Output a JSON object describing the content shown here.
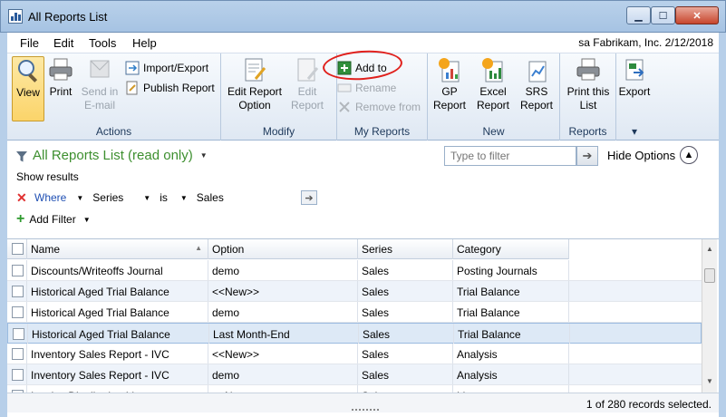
{
  "window": {
    "title": "All Reports List"
  },
  "menu": {
    "items": [
      "File",
      "Edit",
      "Tools",
      "Help"
    ],
    "company": "sa  Fabrikam, Inc.  2/12/2018"
  },
  "ribbon": {
    "actions": {
      "label": "Actions",
      "view": "View",
      "print": "Print",
      "send": "Send in E-mail",
      "import_export": "Import/Export",
      "publish": "Publish Report"
    },
    "modify": {
      "label": "Modify",
      "edit_option": "Edit Report Option",
      "edit_report": "Edit Report"
    },
    "my_reports": {
      "label": "My Reports",
      "add_to": "Add to",
      "rename": "Rename",
      "remove_from": "Remove from"
    },
    "new": {
      "label": "New",
      "gp": "GP Report",
      "excel": "Excel Report",
      "srs": "SRS Report"
    },
    "reports": {
      "label": "Reports",
      "print_list": "Print this List"
    },
    "export": {
      "label": "Export"
    }
  },
  "filter": {
    "list_title": "All Reports List (read only)",
    "search_placeholder": "Type to filter",
    "hide_options": "Hide Options",
    "show_results": "Show results",
    "where": "Where",
    "field": "Series",
    "operator": "is",
    "value": "Sales",
    "add_filter": "Add Filter"
  },
  "grid": {
    "columns": [
      "Name",
      "Option",
      "Series",
      "Category"
    ],
    "rows": [
      {
        "name": "Discounts/Writeoffs Journal",
        "option": "demo",
        "series": "Sales",
        "category": "Posting Journals"
      },
      {
        "name": "Historical Aged Trial Balance",
        "option": "<<New>>",
        "series": "Sales",
        "category": "Trial Balance"
      },
      {
        "name": "Historical Aged Trial Balance",
        "option": "demo",
        "series": "Sales",
        "category": "Trial Balance"
      },
      {
        "name": "Historical Aged Trial Balance",
        "option": "Last Month-End",
        "series": "Sales",
        "category": "Trial Balance"
      },
      {
        "name": "Inventory Sales Report - IVC",
        "option": "<<New>>",
        "series": "Sales",
        "category": "Analysis"
      },
      {
        "name": "Inventory Sales Report - IVC",
        "option": "demo",
        "series": "Sales",
        "category": "Analysis"
      },
      {
        "name": "Invoice Distribution List",
        "option": "<<New>>",
        "series": "Sales",
        "category": "Lists"
      }
    ]
  },
  "status": {
    "records": "1 of 280 records selected."
  }
}
